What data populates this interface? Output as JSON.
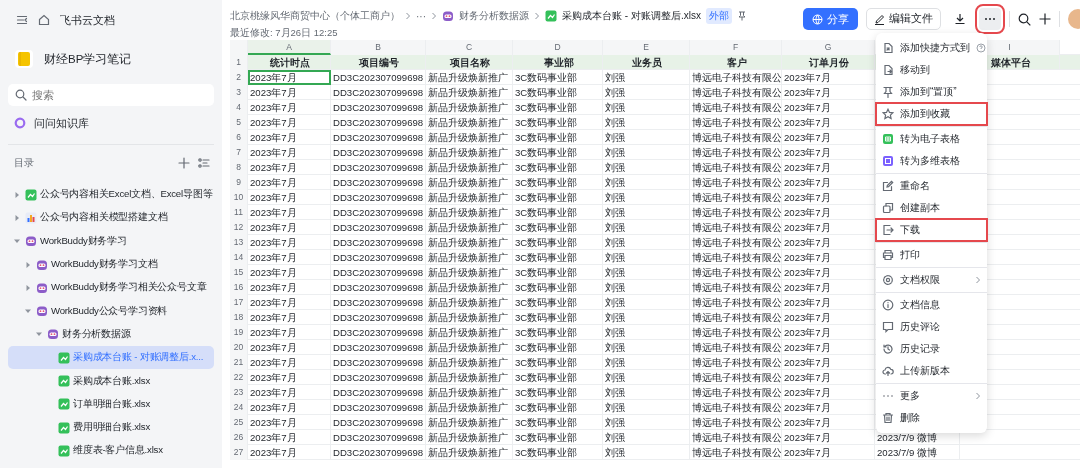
{
  "sidebar": {
    "app_title": "飞书云文档",
    "space_title": "财经BP学习笔记",
    "search": {
      "placeholder": "搜索"
    },
    "ask_label": "问问知识库",
    "tree_title": "目录",
    "tree": [
      {
        "label": "公众号内容相关Excel文档、Excel导图等",
        "kind": "sheet",
        "expanded": false,
        "selected": false
      },
      {
        "label": "公众号内容相关模型搭建文档",
        "kind": "chart",
        "expanded": false,
        "selected": false
      },
      {
        "label": "WorkBuddy财务学习",
        "kind": "bot",
        "expanded": true,
        "selected": false,
        "children": [
          {
            "label": "WorkBuddy财务学习文档",
            "kind": "bot",
            "expanded": false,
            "selected": false
          },
          {
            "label": "WorkBuddy财务学习相关公众号文章",
            "kind": "bot",
            "expanded": false,
            "selected": false
          },
          {
            "label": "WorkBuddy公众号学习资料",
            "kind": "bot",
            "expanded": true,
            "selected": false,
            "children": [
              {
                "label": "财务分析数据源",
                "kind": "bot",
                "expanded": true,
                "selected": false,
                "children": [
                  {
                    "label": "采购成本台账 - 对账调整后.x...",
                    "kind": "sheet",
                    "selected": true
                  },
                  {
                    "label": "采购成本台账.xlsx",
                    "kind": "sheet",
                    "selected": false
                  },
                  {
                    "label": "订单明细台账.xlsx",
                    "kind": "sheet",
                    "selected": false
                  },
                  {
                    "label": "费用明细台账.xlsx",
                    "kind": "sheet",
                    "selected": false
                  },
                  {
                    "label": "维度表-客户信息.xlsx",
                    "kind": "sheet",
                    "selected": false
                  }
                ]
              }
            ]
          }
        ]
      }
    ]
  },
  "header": {
    "breadcrumb": [
      {
        "label": "北京桃缘风华商贸中心（个体工商户）",
        "kind": "text"
      },
      {
        "label": "···",
        "kind": "text"
      },
      {
        "label": "财务分析数据源",
        "kind": "bot"
      },
      {
        "label": "采购成本台账 - 对账调整后.xlsx",
        "kind": "sheet"
      }
    ],
    "badge": "外部",
    "modified": "最近修改: 7月26日 12:25",
    "share_button": "分享",
    "edit_button": "编辑文件",
    "more_highlighted": true
  },
  "table": {
    "columns": [
      {
        "letter": "A",
        "selected": true
      },
      {
        "letter": "B",
        "selected": false
      },
      {
        "letter": "C",
        "selected": false
      },
      {
        "letter": "D",
        "selected": false
      },
      {
        "letter": "E",
        "selected": false
      },
      {
        "letter": "F",
        "selected": false
      },
      {
        "letter": "G",
        "selected": false
      },
      {},
      {
        "letter": "I",
        "selected": false
      }
    ],
    "header_row": {
      "number": "1",
      "cells": [
        "统计时点",
        "项目编号",
        "项目名称",
        "事业部",
        "业务员",
        "客户",
        "订单月份",
        null,
        "媒体平台"
      ]
    },
    "rows": [
      {
        "number": "2",
        "selected": true,
        "cells": [
          "2023年7月",
          "DD3C202307099698",
          "新品升级焕新推广",
          "3C数码事业部",
          "刘强",
          "博远电子科技有限公",
          "2023年7月",
          null,
          null
        ]
      },
      {
        "number": "3",
        "selected": false,
        "cells": [
          "2023年7月",
          "DD3C202307099698",
          "新品升级焕新推广",
          "3C数码事业部",
          "刘强",
          "博远电子科技有限公",
          "2023年7月",
          null,
          null
        ]
      },
      {
        "number": "4",
        "selected": false,
        "cells": [
          "2023年7月",
          "DD3C202307099698",
          "新品升级焕新推广",
          "3C数码事业部",
          "刘强",
          "博远电子科技有限公",
          "2023年7月",
          null,
          null
        ]
      },
      {
        "number": "5",
        "selected": false,
        "cells": [
          "2023年7月",
          "DD3C202307099698",
          "新品升级焕新推广",
          "3C数码事业部",
          "刘强",
          "博远电子科技有限公",
          "2023年7月",
          null,
          null
        ]
      },
      {
        "number": "6",
        "selected": false,
        "cells": [
          "2023年7月",
          "DD3C202307099698",
          "新品升级焕新推广",
          "3C数码事业部",
          "刘强",
          "博远电子科技有限公",
          "2023年7月",
          null,
          null
        ]
      },
      {
        "number": "7",
        "selected": false,
        "cells": [
          "2023年7月",
          "DD3C202307099698",
          "新品升级焕新推广",
          "3C数码事业部",
          "刘强",
          "博远电子科技有限公",
          "2023年7月",
          null,
          null
        ]
      },
      {
        "number": "8",
        "selected": false,
        "cells": [
          "2023年7月",
          "DD3C202307099698",
          "新品升级焕新推广",
          "3C数码事业部",
          "刘强",
          "博远电子科技有限公",
          "2023年7月",
          null,
          null
        ]
      },
      {
        "number": "9",
        "selected": false,
        "cells": [
          "2023年7月",
          "DD3C202307099698",
          "新品升级焕新推广",
          "3C数码事业部",
          "刘强",
          "博远电子科技有限公",
          "2023年7月",
          null,
          null
        ]
      },
      {
        "number": "10",
        "selected": false,
        "cells": [
          "2023年7月",
          "DD3C202307099698",
          "新品升级焕新推广",
          "3C数码事业部",
          "刘强",
          "博远电子科技有限公",
          "2023年7月",
          null,
          null
        ]
      },
      {
        "number": "11",
        "selected": false,
        "cells": [
          "2023年7月",
          "DD3C202307099698",
          "新品升级焕新推广",
          "3C数码事业部",
          "刘强",
          "博远电子科技有限公",
          "2023年7月",
          null,
          null
        ]
      },
      {
        "number": "12",
        "selected": false,
        "cells": [
          "2023年7月",
          "DD3C202307099698",
          "新品升级焕新推广",
          "3C数码事业部",
          "刘强",
          "博远电子科技有限公",
          "2023年7月",
          null,
          null
        ]
      },
      {
        "number": "13",
        "selected": false,
        "cells": [
          "2023年7月",
          "DD3C202307099698",
          "新品升级焕新推广",
          "3C数码事业部",
          "刘强",
          "博远电子科技有限公",
          "2023年7月",
          null,
          null
        ]
      },
      {
        "number": "14",
        "selected": false,
        "cells": [
          "2023年7月",
          "DD3C202307099698",
          "新品升级焕新推广",
          "3C数码事业部",
          "刘强",
          "博远电子科技有限公",
          "2023年7月",
          null,
          null
        ]
      },
      {
        "number": "15",
        "selected": false,
        "cells": [
          "2023年7月",
          "DD3C202307099698",
          "新品升级焕新推广",
          "3C数码事业部",
          "刘强",
          "博远电子科技有限公",
          "2023年7月",
          null,
          null
        ]
      },
      {
        "number": "16",
        "selected": false,
        "cells": [
          "2023年7月",
          "DD3C202307099698",
          "新品升级焕新推广",
          "3C数码事业部",
          "刘强",
          "博远电子科技有限公",
          "2023年7月",
          null,
          null
        ]
      },
      {
        "number": "17",
        "selected": false,
        "cells": [
          "2023年7月",
          "DD3C202307099698",
          "新品升级焕新推广",
          "3C数码事业部",
          "刘强",
          "博远电子科技有限公",
          "2023年7月",
          null,
          null
        ]
      },
      {
        "number": "18",
        "selected": false,
        "cells": [
          "2023年7月",
          "DD3C202307099698",
          "新品升级焕新推广",
          "3C数码事业部",
          "刘强",
          "博远电子科技有限公",
          "2023年7月",
          null,
          null
        ]
      },
      {
        "number": "19",
        "selected": false,
        "cells": [
          "2023年7月",
          "DD3C202307099698",
          "新品升级焕新推广",
          "3C数码事业部",
          "刘强",
          "博远电子科技有限公",
          "2023年7月",
          null,
          null
        ]
      },
      {
        "number": "20",
        "selected": false,
        "cells": [
          "2023年7月",
          "DD3C202307099698",
          "新品升级焕新推广",
          "3C数码事业部",
          "刘强",
          "博远电子科技有限公",
          "2023年7月",
          null,
          null
        ]
      },
      {
        "number": "21",
        "selected": false,
        "cells": [
          "2023年7月",
          "DD3C202307099698",
          "新品升级焕新推广",
          "3C数码事业部",
          "刘强",
          "博远电子科技有限公",
          "2023年7月",
          null,
          null
        ]
      },
      {
        "number": "22",
        "selected": false,
        "cells": [
          "2023年7月",
          "DD3C202307099698",
          "新品升级焕新推广",
          "3C数码事业部",
          "刘强",
          "博远电子科技有限公",
          "2023年7月",
          null,
          null
        ]
      },
      {
        "number": "23",
        "selected": false,
        "cells": [
          "2023年7月",
          "DD3C202307099698",
          "新品升级焕新推广",
          "3C数码事业部",
          "刘强",
          "博远电子科技有限公",
          "2023年7月",
          null,
          null
        ]
      },
      {
        "number": "24",
        "selected": false,
        "cells": [
          "2023年7月",
          "DD3C202307099698",
          "新品升级焕新推广",
          "3C数码事业部",
          "刘强",
          "博远电子科技有限公",
          "2023年7月",
          null,
          null
        ]
      },
      {
        "number": "25",
        "selected": false,
        "cells": [
          "2023年7月",
          "DD3C202307099698",
          "新品升级焕新推广",
          "3C数码事业部",
          "刘强",
          "博远电子科技有限公",
          "2023年7月",
          null,
          null
        ]
      },
      {
        "number": "26",
        "selected": false,
        "cells": [
          "2023年7月",
          "DD3C202307099698",
          "新品升级焕新推广",
          "3C数码事业部",
          "刘强",
          "博远电子科技有限公",
          "2023年7月",
          "2023/7/9 微博",
          null
        ]
      },
      {
        "number": "27",
        "selected": false,
        "cells": [
          "2023年7月",
          "DD3C202307099698",
          "新品升级焕新推广",
          "3C数码事业部",
          "刘强",
          "博远电子科技有限公",
          "2023年7月",
          "2023/7/9 微博",
          null
        ]
      }
    ]
  },
  "menu": {
    "groups": [
      [
        {
          "label": "添加快捷方式到",
          "kind": "shortcut",
          "help": true,
          "submenu": false,
          "highlighted": false
        },
        {
          "label": "移动到",
          "kind": "move",
          "help": false,
          "submenu": false,
          "highlighted": false
        },
        {
          "label": "添加到“置顶”",
          "kind": "pin",
          "help": false,
          "submenu": false,
          "highlighted": false
        },
        {
          "label": "添加到收藏",
          "kind": "star",
          "help": false,
          "submenu": false,
          "highlighted": true
        }
      ],
      [
        {
          "label": "转为电子表格",
          "kind": "sheet",
          "help": false,
          "submenu": false,
          "highlighted": false
        },
        {
          "label": "转为多维表格",
          "kind": "base",
          "help": false,
          "submenu": false,
          "highlighted": false
        }
      ],
      [
        {
          "label": "重命名",
          "kind": "rename",
          "help": false,
          "submenu": false,
          "highlighted": false
        },
        {
          "label": "创建副本",
          "kind": "copy",
          "help": false,
          "submenu": false,
          "highlighted": false
        },
        {
          "label": "下载",
          "kind": "download",
          "help": false,
          "submenu": false,
          "highlighted": true
        }
      ],
      [
        {
          "label": "打印",
          "kind": "print",
          "help": false,
          "submenu": false,
          "highlighted": false
        }
      ],
      [
        {
          "label": "文档权限",
          "kind": "settings",
          "help": false,
          "submenu": true,
          "highlighted": false
        }
      ],
      [
        {
          "label": "文档信息",
          "kind": "info",
          "help": false,
          "submenu": false,
          "highlighted": false
        },
        {
          "label": "历史评论",
          "kind": "comment",
          "help": false,
          "submenu": false,
          "highlighted": false
        },
        {
          "label": "历史记录",
          "kind": "history",
          "help": false,
          "submenu": false,
          "highlighted": false
        },
        {
          "label": "上传新版本",
          "kind": "upload",
          "help": false,
          "submenu": false,
          "highlighted": false
        }
      ],
      [
        {
          "label": "更多",
          "kind": "more",
          "help": false,
          "submenu": true,
          "highlighted": false
        },
        {
          "label": "删除",
          "kind": "delete",
          "help": false,
          "submenu": false,
          "highlighted": false
        }
      ]
    ]
  }
}
